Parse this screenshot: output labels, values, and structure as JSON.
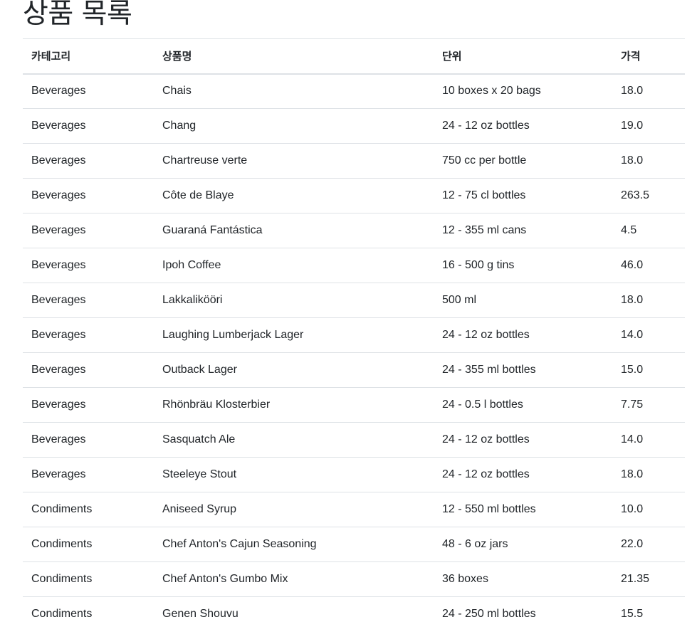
{
  "page": {
    "title": "상품 목록"
  },
  "table": {
    "headers": {
      "category": "카테고리",
      "name": "상품명",
      "unit": "단위",
      "price": "가격"
    },
    "rows": [
      {
        "category": "Beverages",
        "name": "Chais",
        "unit": "10 boxes x 20 bags",
        "price": "18.0"
      },
      {
        "category": "Beverages",
        "name": "Chang",
        "unit": "24 - 12 oz bottles",
        "price": "19.0"
      },
      {
        "category": "Beverages",
        "name": "Chartreuse verte",
        "unit": "750 cc per bottle",
        "price": "18.0"
      },
      {
        "category": "Beverages",
        "name": "Côte de Blaye",
        "unit": "12 - 75 cl bottles",
        "price": "263.5"
      },
      {
        "category": "Beverages",
        "name": "Guaraná Fantástica",
        "unit": "12 - 355 ml cans",
        "price": "4.5"
      },
      {
        "category": "Beverages",
        "name": "Ipoh Coffee",
        "unit": "16 - 500 g tins",
        "price": "46.0"
      },
      {
        "category": "Beverages",
        "name": "Lakkalikööri",
        "unit": "500 ml",
        "price": "18.0"
      },
      {
        "category": "Beverages",
        "name": "Laughing Lumberjack Lager",
        "unit": "24 - 12 oz bottles",
        "price": "14.0"
      },
      {
        "category": "Beverages",
        "name": "Outback Lager",
        "unit": "24 - 355 ml bottles",
        "price": "15.0"
      },
      {
        "category": "Beverages",
        "name": "Rhönbräu Klosterbier",
        "unit": "24 - 0.5 l bottles",
        "price": "7.75"
      },
      {
        "category": "Beverages",
        "name": "Sasquatch Ale",
        "unit": "24 - 12 oz bottles",
        "price": "14.0"
      },
      {
        "category": "Beverages",
        "name": "Steeleye Stout",
        "unit": "24 - 12 oz bottles",
        "price": "18.0"
      },
      {
        "category": "Condiments",
        "name": "Aniseed Syrup",
        "unit": "12 - 550 ml bottles",
        "price": "10.0"
      },
      {
        "category": "Condiments",
        "name": "Chef Anton's Cajun Seasoning",
        "unit": "48 - 6 oz jars",
        "price": "22.0"
      },
      {
        "category": "Condiments",
        "name": "Chef Anton's Gumbo Mix",
        "unit": "36 boxes",
        "price": "21.35"
      },
      {
        "category": "Condiments",
        "name": "Genen Shouyu",
        "unit": "24 - 250 ml bottles",
        "price": "15.5"
      }
    ]
  },
  "colors": {
    "text": "#212529",
    "border": "#dee2e6",
    "background": "#ffffff"
  }
}
